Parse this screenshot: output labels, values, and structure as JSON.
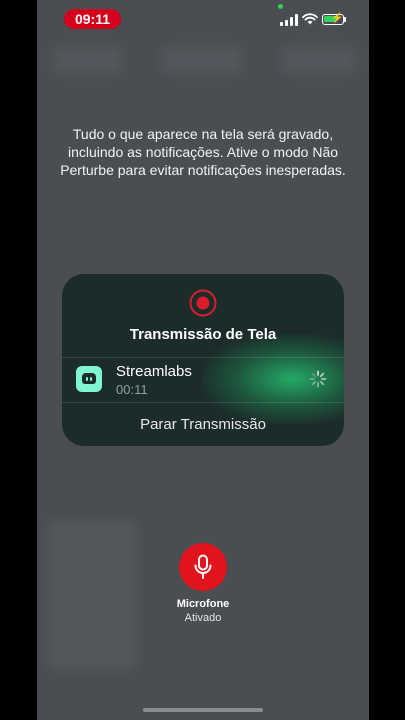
{
  "status_bar": {
    "time": "09:11",
    "recording_color": "#d5001c",
    "battery_color": "#36d35a"
  },
  "notice": {
    "text": "Tudo o que aparece na tela será gravado, incluindo as notificações. Ative o modo Não Perturbe para evitar notificações inesperadas."
  },
  "broadcast_panel": {
    "title": "Transmissão de Tela",
    "icon": "record-icon",
    "app": {
      "name": "Streamlabs",
      "elapsed": "00:11",
      "icon": "streamlabs-icon",
      "status_icon": "loading-spinner-icon"
    },
    "stop_label": "Parar Transmissão"
  },
  "microphone": {
    "label": "Microfone",
    "status": "Ativado",
    "color": "#e0141d",
    "icon": "microphone-icon"
  }
}
